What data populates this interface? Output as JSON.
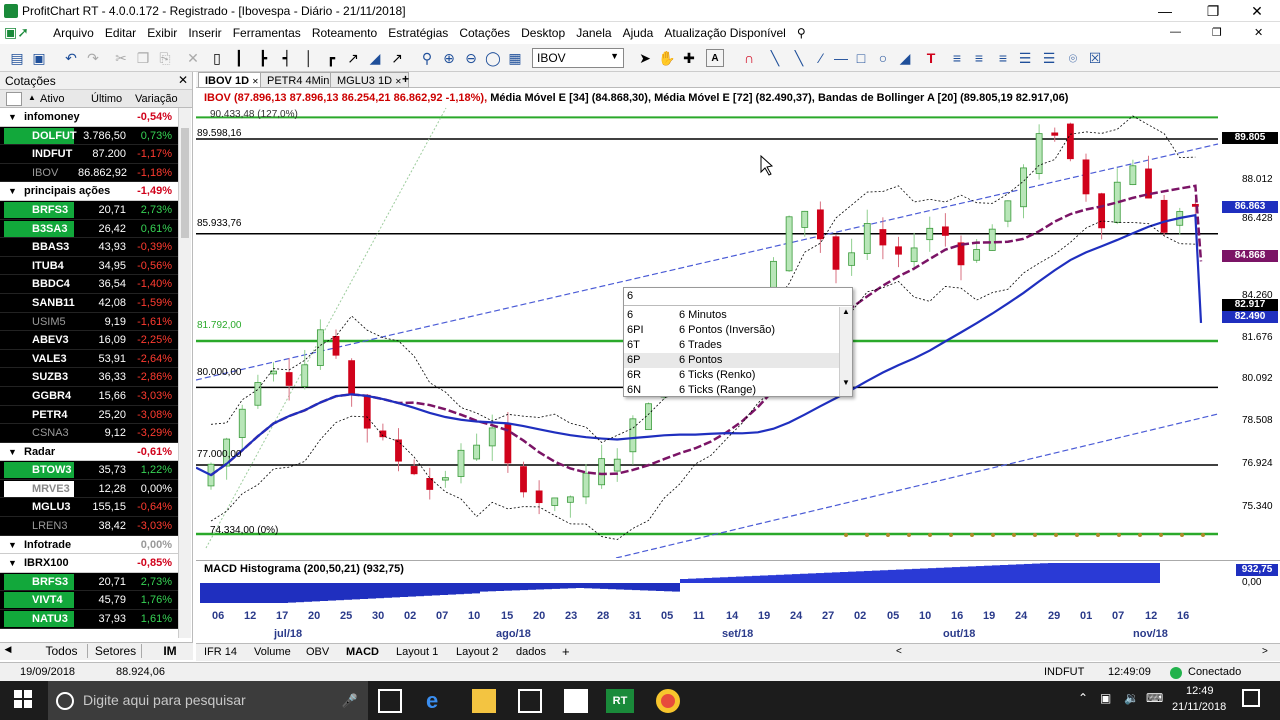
{
  "window": {
    "title": "ProfitChart RT - 4.0.0.172 - Registrado - [Ibovespa - Diário - 21/11/2018]"
  },
  "menu": [
    "Arquivo",
    "Editar",
    "Exibir",
    "Inserir",
    "Ferramentas",
    "Roteamento",
    "Estratégias",
    "Cotações",
    "Desktop",
    "Janela",
    "Ajuda",
    "Atualização Disponível"
  ],
  "toolbar": {
    "symbol": "IBOV"
  },
  "quotes": {
    "title": "Cotações",
    "columns": [
      "Ativo",
      "Último",
      "Variação"
    ],
    "rows": [
      {
        "type": "group",
        "name": "infomoney",
        "change": "-0,54%"
      },
      {
        "type": "asset",
        "ticker": "DOLFUT",
        "last": "3.786,50",
        "change": "0,73%",
        "dir": "up"
      },
      {
        "type": "asset",
        "ticker": "INDFUT",
        "last": "87.200",
        "change": "-1,17%",
        "dir": "dn"
      },
      {
        "type": "asset",
        "ticker": "IBOV",
        "last": "86.862,92",
        "change": "-1,18%",
        "dir": "dim"
      },
      {
        "type": "group",
        "name": "principais ações",
        "change": "-1,49%"
      },
      {
        "type": "asset",
        "ticker": "BRFS3",
        "last": "20,71",
        "change": "2,73%",
        "dir": "up"
      },
      {
        "type": "asset",
        "ticker": "B3SA3",
        "last": "26,42",
        "change": "0,61%",
        "dir": "up"
      },
      {
        "type": "asset",
        "ticker": "BBAS3",
        "last": "43,93",
        "change": "-0,39%",
        "dir": "dn"
      },
      {
        "type": "asset",
        "ticker": "ITUB4",
        "last": "34,95",
        "change": "-0,56%",
        "dir": "dn"
      },
      {
        "type": "asset",
        "ticker": "BBDC4",
        "last": "36,54",
        "change": "-1,40%",
        "dir": "dn"
      },
      {
        "type": "asset",
        "ticker": "SANB11",
        "last": "42,08",
        "change": "-1,59%",
        "dir": "dn"
      },
      {
        "type": "asset",
        "ticker": "USIM5",
        "last": "9,19",
        "change": "-1,61%",
        "dir": "dim"
      },
      {
        "type": "asset",
        "ticker": "ABEV3",
        "last": "16,09",
        "change": "-2,25%",
        "dir": "dn"
      },
      {
        "type": "asset",
        "ticker": "VALE3",
        "last": "53,91",
        "change": "-2,64%",
        "dir": "dn"
      },
      {
        "type": "asset",
        "ticker": "SUZB3",
        "last": "36,33",
        "change": "-2,86%",
        "dir": "dn"
      },
      {
        "type": "asset",
        "ticker": "GGBR4",
        "last": "15,66",
        "change": "-3,03%",
        "dir": "dn"
      },
      {
        "type": "asset",
        "ticker": "PETR4",
        "last": "25,20",
        "change": "-3,08%",
        "dir": "dn"
      },
      {
        "type": "asset",
        "ticker": "CSNA3",
        "last": "9,12",
        "change": "-3,29%",
        "dir": "dim"
      },
      {
        "type": "group",
        "name": "Radar",
        "change": "-0,61%"
      },
      {
        "type": "asset",
        "ticker": "BTOW3",
        "last": "35,73",
        "change": "1,22%",
        "dir": "up"
      },
      {
        "type": "asset",
        "ticker": "MRVE3",
        "last": "12,28",
        "change": "0,00%",
        "dir": "flat"
      },
      {
        "type": "asset",
        "ticker": "MGLU3",
        "last": "155,15",
        "change": "-0,64%",
        "dir": "dn"
      },
      {
        "type": "asset",
        "ticker": "LREN3",
        "last": "38,42",
        "change": "-3,03%",
        "dir": "dim"
      },
      {
        "type": "group",
        "name": "Infotrade",
        "change": "0,00%"
      },
      {
        "type": "group",
        "name": "IBRX100",
        "change": "-0,85%"
      },
      {
        "type": "asset",
        "ticker": "BRFS3",
        "last": "20,71",
        "change": "2,73%",
        "dir": "up"
      },
      {
        "type": "asset",
        "ticker": "VIVT4",
        "last": "45,79",
        "change": "1,76%",
        "dir": "up"
      },
      {
        "type": "asset",
        "ticker": "NATU3",
        "last": "37,93",
        "change": "1,61%",
        "dir": "up"
      }
    ],
    "tabs": [
      "Todos",
      "Setores",
      "IM"
    ]
  },
  "chart_tabs": [
    "IBOV 1D",
    "PETR4 4Min",
    "MGLU3 1D"
  ],
  "chart": {
    "header_series": "IBOV (87.896,13  87.896,13  86.254,21  86.862,92  -1,18%),",
    "header_ma1": "Média Móvel E [34] (84.868,30),",
    "header_ma2": "Média Móvel E [72] (82.490,37),",
    "header_bb": "Bandas de Bollinger A [20] (89.805,19  82.917,06)",
    "level_top": "90.433,48 (127,0%)",
    "level_labels": [
      "89.598,16",
      "85.933,76",
      "81.792,00",
      "80.000,00",
      "77.000,00",
      "74.334,00 (0%)"
    ],
    "price_scale": [
      "89.805",
      "88.012",
      "86.863",
      "86.428",
      "84.868",
      "84.260",
      "82.917",
      "82.490",
      "81.676",
      "80.092",
      "78.508",
      "76.924",
      "75.340"
    ],
    "macd_label": "MACD Histograma (200,50,21) (932,75)",
    "macd_scale": [
      "932,75",
      "0,00"
    ],
    "x_days": [
      "06",
      "12",
      "17",
      "20",
      "25",
      "30",
      "02",
      "07",
      "10",
      "15",
      "20",
      "23",
      "28",
      "31",
      "05",
      "11",
      "14",
      "19",
      "24",
      "27",
      "02",
      "05",
      "10",
      "16",
      "19",
      "24",
      "29",
      "01",
      "07",
      "12",
      "16"
    ],
    "x_months": [
      "jul/18",
      "ago/18",
      "set/18",
      "out/18",
      "nov/18"
    ]
  },
  "autocomplete": {
    "input": "6",
    "items": [
      {
        "code": "6",
        "desc": "6 Minutos"
      },
      {
        "code": "6PI",
        "desc": "6 Pontos (Inversão)"
      },
      {
        "code": "6T",
        "desc": "6 Trades"
      },
      {
        "code": "6P",
        "desc": "6 Pontos"
      },
      {
        "code": "6R",
        "desc": "6 Ticks (Renko)"
      },
      {
        "code": "6N",
        "desc": "6 Ticks (Range)"
      }
    ]
  },
  "bottom_tabs": [
    "IFR 14",
    "Volume",
    "OBV",
    "MACD",
    "Layout 1",
    "Layout 2",
    "dados"
  ],
  "status": {
    "date": "19/09/2018",
    "value": "88.924,06",
    "asset": "INDFUT",
    "time": "12:49:09",
    "connection": "Conectado"
  },
  "taskbar": {
    "search_placeholder": "Digite aqui para pesquisar",
    "time": "12:49",
    "date": "21/11/2018"
  },
  "colors": {
    "bull": "#12a83b",
    "bear": "#d0021b",
    "ma34": "#7b1466",
    "ma72": "#1f2fbf",
    "bollinger": "#000000",
    "support": "#2aa92a",
    "trend": "#4a5bd6"
  }
}
